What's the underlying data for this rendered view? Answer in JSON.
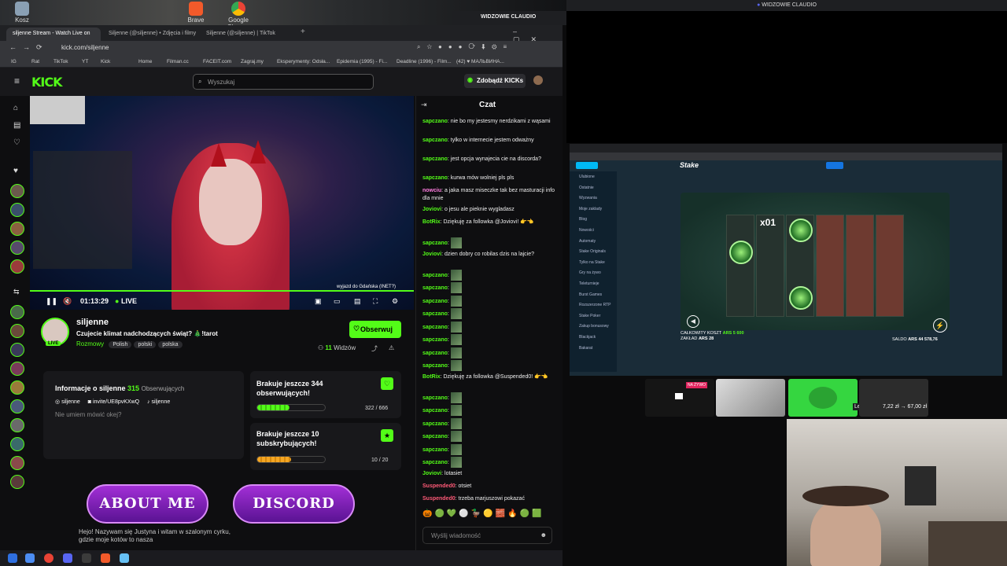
{
  "desktop": {
    "icons": [
      {
        "label": "Kosz"
      },
      {
        "label": "Brave"
      },
      {
        "label": "Google Chrome"
      }
    ],
    "discord_title": "WIDZOWIE CLAUDIO",
    "overlay_title": "WIDZOWIE CLAUDIO"
  },
  "browser": {
    "tabs": [
      "siljenne Stream - Watch Live on",
      "Siljenne (@siljenne) • Zdjęcia i filmy",
      "Siljenne (@siljenne) | TikTok"
    ],
    "url": "kick.com/siljenne",
    "bookmarks": [
      "IG",
      "Rat",
      "TikTok",
      "YT",
      "Kick",
      "Home",
      "Filman.cc",
      "FACEIT.com",
      "Zagraj.my",
      "Eksperymenty: Odsła...",
      "Epidemia (1995) - Fi...",
      "Deadline (1996) - Film...",
      "(42) ♥ МАЛЬВИНА..."
    ]
  },
  "kick": {
    "logo": "KICK",
    "search_placeholder": "Wyszukaj",
    "kicks_button": "Zdobądź KICKs",
    "video": {
      "time": "01:13:29",
      "live": "LIVE",
      "overlay_text": "wyjazd do Gdańska (INET?)"
    },
    "streamer": {
      "name": "siljenne",
      "title": "Czujecie klimat nadchodzących świąt? 🎄!tarot",
      "category": "Rozmowy",
      "tags": [
        "Polish",
        "polski",
        "polska"
      ],
      "viewers": "11",
      "viewers_label": "Widzów",
      "follow": "Obserwuj",
      "live_badge": "LIVE"
    },
    "about": {
      "heading": "Informacje o siljenne",
      "followers": "315",
      "followers_label": "Obserwujących",
      "links": [
        "siljenne",
        "invite/UE8pvKXwQ",
        "siljenne"
      ],
      "bio": "Nie umiem mówić okej?"
    },
    "goals": [
      {
        "title": "Brakuje jeszcze 344 obserwujących!",
        "progress": "322 / 666",
        "fraction": 0.48
      },
      {
        "title": "Brakuje jeszcze 10 subskrybujących!",
        "progress": "10 / 20",
        "fraction": 0.5
      }
    ],
    "banners": [
      "ABOUT ME",
      "DISCORD"
    ],
    "bio_panel": "Hejo! Nazywam się Justyna i witam w szalonym cyrku, gdzie moje kotów to nasza",
    "chat": {
      "title": "Czat",
      "messages": [
        {
          "user": "sapczano",
          "color": "#53fc18",
          "text": "nie bo my jestesmy nerdzikami z wąsami"
        },
        {
          "user": "sapczano",
          "color": "#53fc18",
          "text": "tylko w internecie jestem odważny"
        },
        {
          "user": "sapczano",
          "color": "#53fc18",
          "text": "jest opcja wynajecia cie na discorda?"
        },
        {
          "user": "sapczano",
          "color": "#53fc18",
          "text": "kurwa mów wolniej pls pls"
        },
        {
          "user": "nowciu",
          "color": "#ff7de0",
          "text": "a jaka masz miseczke tak bez masturacji info dla mnie"
        },
        {
          "user": "Joviovi",
          "color": "#53fc18",
          "text": "o jesu ale pieknie wygladasz"
        },
        {
          "user": "BotRix",
          "color": "#53fc18",
          "text": "Dziękuję za followka @Joviovi! 👉👈"
        },
        {
          "user": "sapczano",
          "color": "#53fc18",
          "text": ""
        },
        {
          "user": "Joviovi",
          "color": "#53fc18",
          "text": "dzien dobry co robilas dzis na lajcie?"
        },
        {
          "user": "sapczano",
          "color": "#53fc18",
          "text": ""
        },
        {
          "user": "sapczano",
          "color": "#53fc18",
          "text": ""
        },
        {
          "user": "sapczano",
          "color": "#53fc18",
          "text": ""
        },
        {
          "user": "sapczano",
          "color": "#53fc18",
          "text": ""
        },
        {
          "user": "sapczano",
          "color": "#53fc18",
          "text": ""
        },
        {
          "user": "sapczano",
          "color": "#53fc18",
          "text": ""
        },
        {
          "user": "sapczano",
          "color": "#53fc18",
          "text": ""
        },
        {
          "user": "sapczano",
          "color": "#53fc18",
          "text": ""
        },
        {
          "user": "BotRix",
          "color": "#53fc18",
          "text": "Dziękuję za followka @Suspended0! 👉👈"
        },
        {
          "user": "sapczano",
          "color": "#53fc18",
          "text": ""
        },
        {
          "user": "sapczano",
          "color": "#53fc18",
          "text": ""
        },
        {
          "user": "sapczano",
          "color": "#53fc18",
          "text": ""
        },
        {
          "user": "sapczano",
          "color": "#53fc18",
          "text": ""
        },
        {
          "user": "sapczano",
          "color": "#53fc18",
          "text": ""
        },
        {
          "user": "sapczano",
          "color": "#53fc18",
          "text": ""
        },
        {
          "user": "Joviovi",
          "color": "#53fc18",
          "text": "lotasiet"
        },
        {
          "user": "Suspended0",
          "color": "#ff5a77",
          "text": "otsiet"
        },
        {
          "user": "Suspended0",
          "color": "#ff5a77",
          "text": "trzeba marjuszowi pokazać"
        }
      ],
      "input_placeholder": "Wyślij wiadomość"
    }
  },
  "stake": {
    "logo": "Stake",
    "sidebar": [
      "Ulubione",
      "Ostatnie",
      "Wyzwania",
      "Moje zaklady",
      "Blog",
      "Nowości",
      "Automaty",
      "Stake Originals",
      "Tylko na Stake",
      "Gry na żywo",
      "Teleturnieje",
      "Burst Games",
      "Rozszerzone RTP",
      "Stake Poker",
      "Zakup bonusowy",
      "Blackjack",
      "Bakarat"
    ],
    "multiplier": "x01",
    "total_label": "CAŁKOWITY KOSZT",
    "total_value": "ARS 5 600",
    "bet_label": "ZAKŁAD",
    "bet_value": "ARS 28",
    "balance_label": "SALDO",
    "balance_value": "ARS 44 578,76"
  },
  "thumbs": {
    "live_badge": "NA ŻYWO",
    "label": "Lepszy 2026",
    "price": "7,22 zł → 67,00 zł"
  }
}
